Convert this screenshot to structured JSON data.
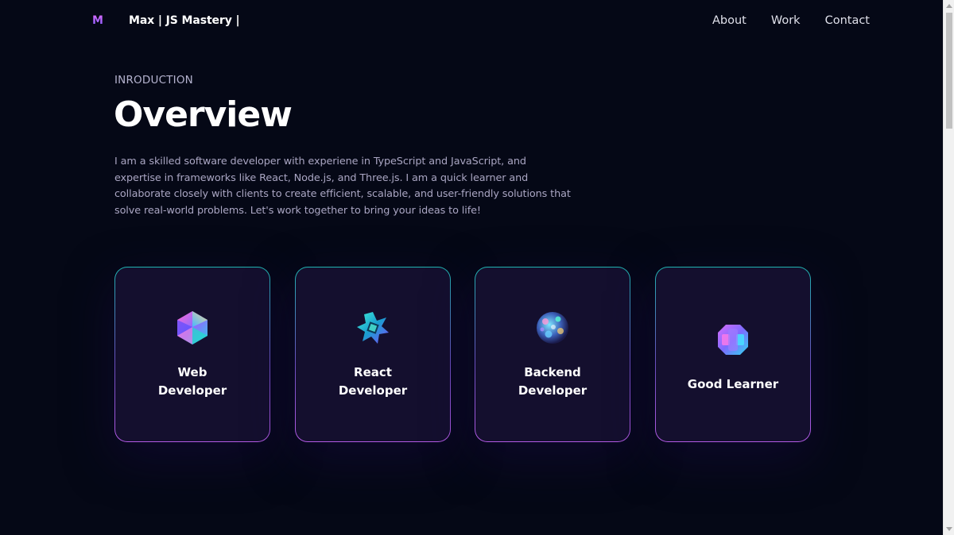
{
  "navbar": {
    "logo": "M",
    "brand": "Max | JS Mastery |",
    "links": [
      "About",
      "Work",
      "Contact"
    ]
  },
  "section": {
    "kicker": "INRODUCTION",
    "title": "Overview",
    "description": "I am a skilled software developer with experiene in TypeScript and JavaScript, and expertise in frameworks like React, Node.js, and Three.js. I am a quick learner and collaborate closely with clients to create efficient, scalable, and user-friendly solutions that solve real-world problems. Let's work together to bring your ideas to life!"
  },
  "cards": [
    {
      "title": "Web\nDeveloper",
      "icon": "crystal-icosahedron-icon"
    },
    {
      "title": "React\nDeveloper",
      "icon": "cube-star-icon"
    },
    {
      "title": "Backend\nDeveloper",
      "icon": "sphere-orb-icon"
    },
    {
      "title": "Good Learner",
      "icon": "puzzle-shape-icon"
    }
  ],
  "colors": {
    "background": "#050816",
    "card_background": "#140f2e",
    "card_border_top": "#1fb4b0",
    "card_border_bottom": "#b45ae6",
    "text_secondary": "#aaa6c3",
    "logo_gradient_start": "#e26cff",
    "logo_gradient_end": "#7b5cff"
  }
}
